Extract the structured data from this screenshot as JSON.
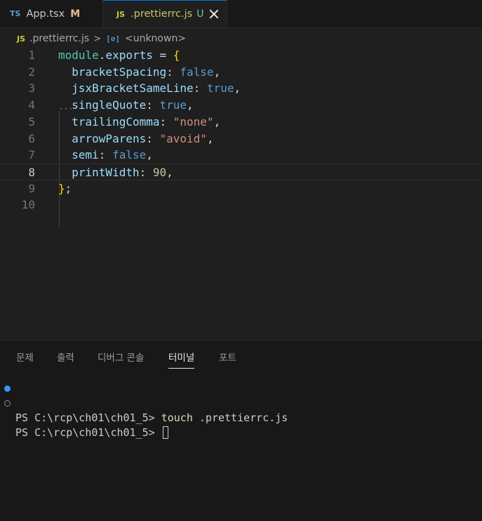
{
  "tabs": [
    {
      "icon": "TS",
      "name": "App.tsx",
      "git_status": "M"
    },
    {
      "icon": "JS",
      "name": ".prettierrc.js",
      "git_status": "U"
    }
  ],
  "breadcrumb": {
    "icon": "JS",
    "file": ".prettierrc.js",
    "symbol_icon": "[⊘]",
    "symbol": "<unknown>"
  },
  "editor": {
    "current_line": 8,
    "line_numbers": [
      "1",
      "2",
      "3",
      "4",
      "5",
      "6",
      "7",
      "8",
      "9",
      "10"
    ],
    "lines": [
      [
        [
          "module",
          "var"
        ],
        [
          ".",
          "punc"
        ],
        [
          "exports",
          "prop"
        ],
        [
          " = ",
          "punc"
        ],
        [
          "{",
          "brace"
        ]
      ],
      [
        [
          "  bracketSpacing",
          "prop"
        ],
        [
          ": ",
          "punc"
        ],
        [
          "false",
          "bool"
        ],
        [
          ",",
          "punc"
        ]
      ],
      [
        [
          "  jsxBracketSameLine",
          "prop"
        ],
        [
          ": ",
          "punc"
        ],
        [
          "true",
          "bool"
        ],
        [
          ",",
          "punc"
        ]
      ],
      [
        [
          "  singleQuote",
          "prop"
        ],
        [
          ": ",
          "punc"
        ],
        [
          "true",
          "bool"
        ],
        [
          ",",
          "punc"
        ]
      ],
      [
        [
          "  trailingComma",
          "prop"
        ],
        [
          ": ",
          "punc"
        ],
        [
          "\"none\"",
          "str"
        ],
        [
          ",",
          "punc"
        ]
      ],
      [
        [
          "  arrowParens",
          "prop"
        ],
        [
          ": ",
          "punc"
        ],
        [
          "\"avoid\"",
          "str"
        ],
        [
          ",",
          "punc"
        ]
      ],
      [
        [
          "  semi",
          "prop"
        ],
        [
          ": ",
          "punc"
        ],
        [
          "false",
          "bool"
        ],
        [
          ",",
          "punc"
        ]
      ],
      [
        [
          "  printWidth",
          "prop"
        ],
        [
          ": ",
          "punc"
        ],
        [
          "90",
          "num"
        ],
        [
          ",",
          "punc"
        ]
      ],
      [
        [
          "}",
          "brace"
        ],
        [
          ";",
          "punc"
        ]
      ],
      []
    ]
  },
  "panel": {
    "tabs": [
      "문제",
      "출력",
      "디버그 콘솔",
      "터미널",
      "포트"
    ],
    "active_tab": "터미널",
    "terminal": [
      {
        "prompt": "PS C:\\rcp\\ch01\\ch01_5> ",
        "command": "touch",
        "args": " .prettierrc.js",
        "status": "success"
      },
      {
        "prompt": "PS C:\\rcp\\ch01\\ch01_5> ",
        "command": "",
        "args": "",
        "status": "pending"
      }
    ]
  }
}
